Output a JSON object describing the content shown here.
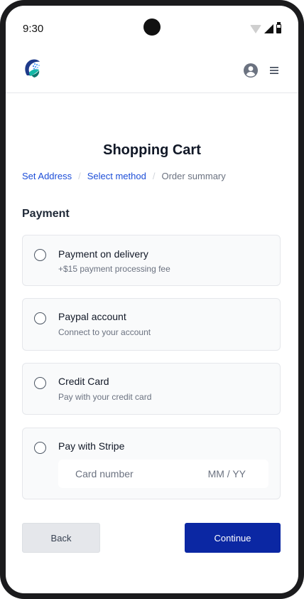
{
  "status_bar": {
    "time": "9:30"
  },
  "header": {
    "logo": "logo-icon",
    "profile": "user-circle-icon",
    "menu": "hamburger-menu-icon"
  },
  "page": {
    "title": "Shopping Cart"
  },
  "breadcrumb": {
    "step1": "Set Address",
    "step2": "Select method",
    "step3": "Order summary",
    "separator": "/"
  },
  "payment": {
    "section_title": "Payment",
    "options": [
      {
        "title": "Payment on delivery",
        "description": "+$15 payment processing fee"
      },
      {
        "title": "Paypal account",
        "description": "Connect to your account"
      },
      {
        "title": "Credit Card",
        "description": "Pay with your credit card"
      },
      {
        "title": "Pay with Stripe"
      }
    ],
    "stripe": {
      "card_placeholder": "Card number",
      "expiry_placeholder": "MM / YY"
    }
  },
  "actions": {
    "back": "Back",
    "continue": "Continue"
  },
  "colors": {
    "accent": "#0b27a3",
    "link": "#1d4ed8",
    "card_bg": "#f9fafb",
    "border": "#e5e7eb"
  }
}
